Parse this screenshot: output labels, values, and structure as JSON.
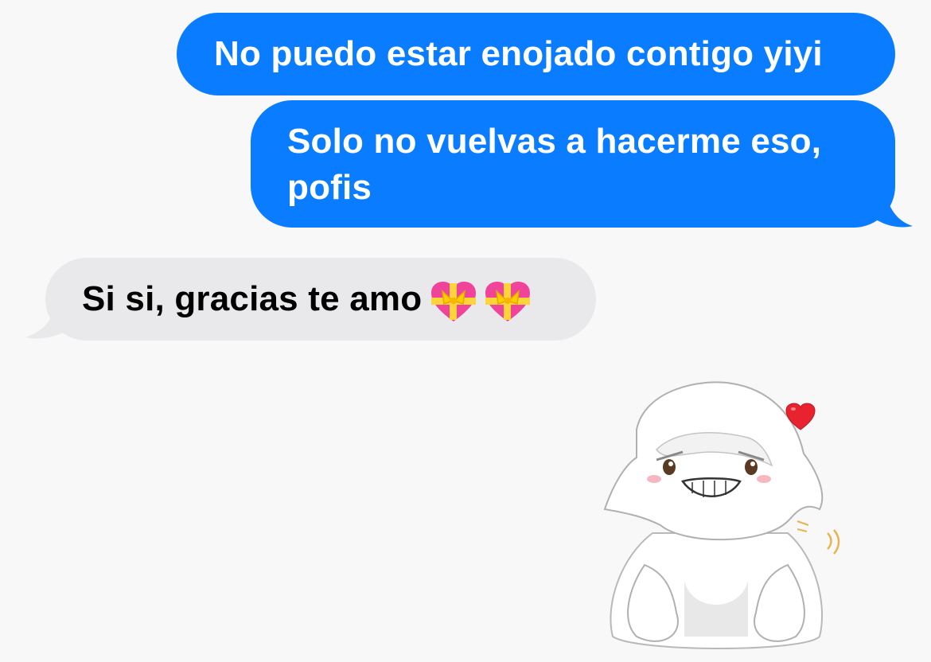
{
  "conversation": {
    "messages": [
      {
        "sender": "me",
        "text": "No puedo estar enojado contigo yiyi"
      },
      {
        "sender": "me",
        "lines": [
          "Solo no vuelvas a hacerme eso,",
          "pofis"
        ]
      },
      {
        "sender": "them",
        "text": "Si si, gracias te amo",
        "emoji": [
          "heart-with-ribbon",
          "heart-with-ribbon"
        ]
      },
      {
        "sender": "me",
        "sticker": "white-fluffy-creature-grinning-with-red-heart"
      }
    ]
  },
  "colors": {
    "sent_bubble": "#0a7cff",
    "received_bubble": "#e9e9eb",
    "background": "#f8f8f8"
  }
}
